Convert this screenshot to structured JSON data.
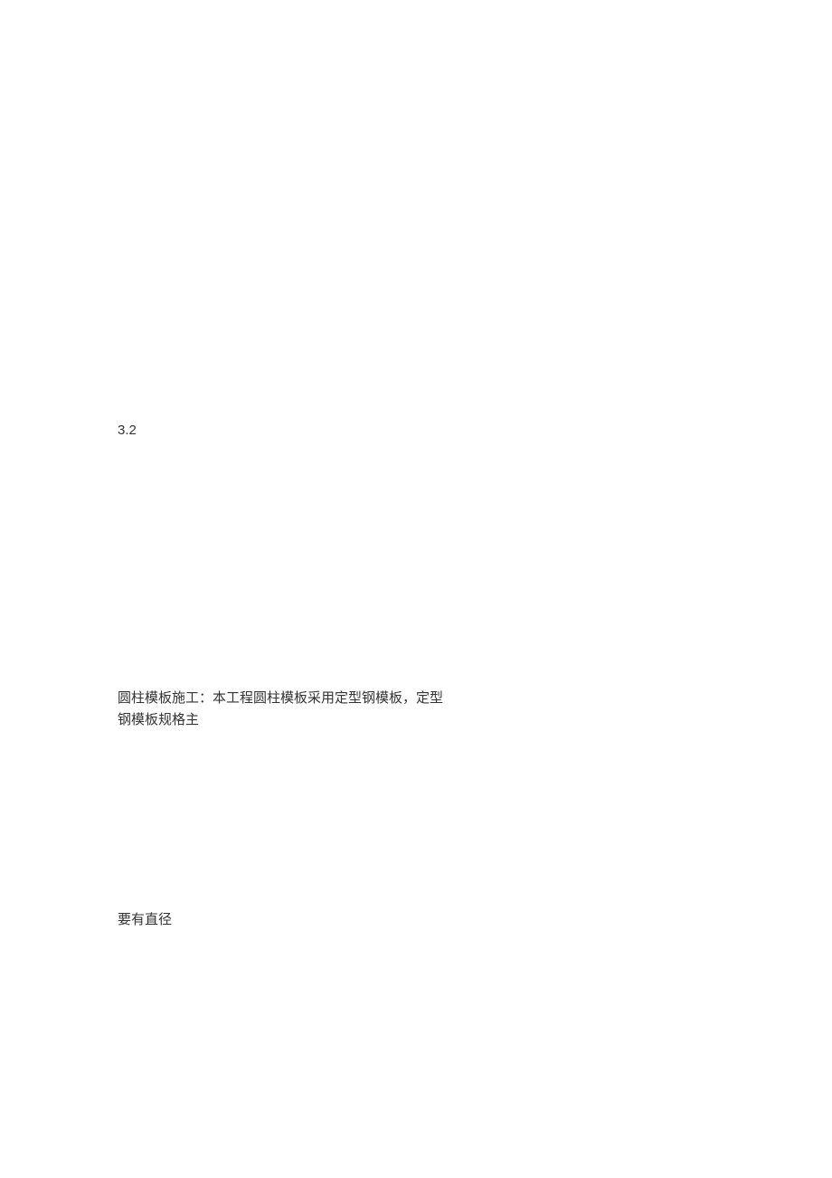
{
  "section": {
    "number": "3.2"
  },
  "paragraphs": {
    "p1_line1": "圆柱模板施工：本工程圆柱模板采用定型钢模板，定型",
    "p1_line2": "钢模板规格主",
    "p2": "要有直径"
  }
}
